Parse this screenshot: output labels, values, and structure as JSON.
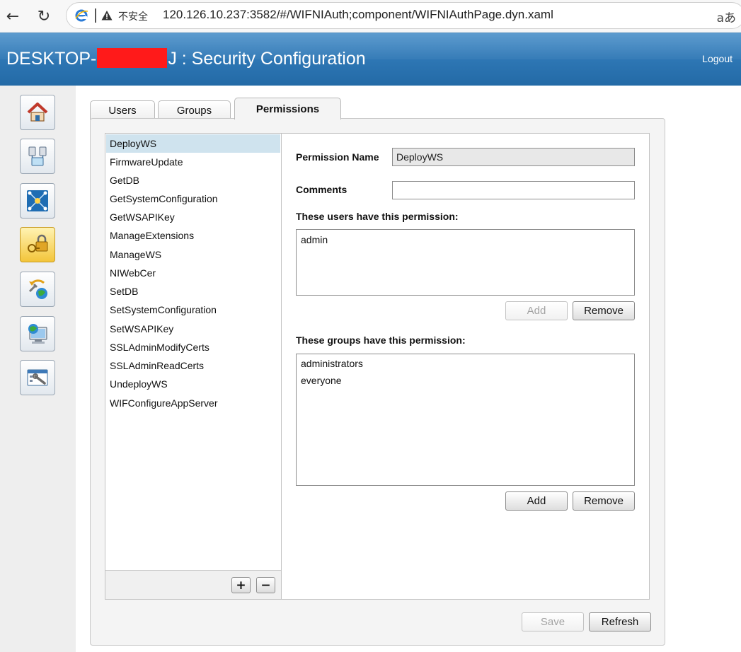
{
  "browser": {
    "insecure_label": "不安全",
    "url": "120.126.10.237:3582/#/WIFNIAuth;component/WIFNIAuthPage.dyn.xaml",
    "reader_label": "aあ",
    "back_icon": "back-arrow-icon",
    "refresh_icon": "refresh-icon"
  },
  "header": {
    "title_prefix": "DESKTOP-",
    "title_suffix": "J : Security Configuration",
    "logout_label": "Logout",
    "color": "#2f78b6"
  },
  "left_nav": {
    "items": [
      {
        "icon": "home-icon"
      },
      {
        "icon": "network-devices-icon"
      },
      {
        "icon": "network-topology-icon"
      },
      {
        "icon": "security-lock-icon",
        "active": true
      },
      {
        "icon": "software-update-icon"
      },
      {
        "icon": "web-server-icon"
      },
      {
        "icon": "settings-wrench-icon"
      }
    ]
  },
  "tabs": [
    {
      "label": "Users"
    },
    {
      "label": "Groups"
    },
    {
      "label": "Permissions",
      "active": true
    }
  ],
  "permissions": {
    "selected": "DeployWS",
    "items": [
      "DeployWS",
      "FirmwareUpdate",
      "GetDB",
      "GetSystemConfiguration",
      "GetWSAPIKey",
      "ManageExtensions",
      "ManageWS",
      "NIWebCer",
      "SetDB",
      "SetSystemConfiguration",
      "SetWSAPIKey",
      "SSLAdminModifyCerts",
      "SSLAdminReadCerts",
      "UndeployWS",
      "WIFConfigureAppServer"
    ],
    "add_label": "+",
    "remove_label": "−"
  },
  "detail": {
    "permission_name_label": "Permission Name",
    "permission_name_value": "DeployWS",
    "comments_label": "Comments",
    "comments_value": "",
    "users_label": "These users have this permission:",
    "users": [
      "admin"
    ],
    "users_add_label": "Add",
    "users_remove_label": "Remove",
    "groups_label": "These groups have this permission:",
    "groups": [
      "administrators",
      "everyone"
    ],
    "groups_add_label": "Add",
    "groups_remove_label": "Remove"
  },
  "footer": {
    "save_label": "Save",
    "refresh_label": "Refresh"
  }
}
